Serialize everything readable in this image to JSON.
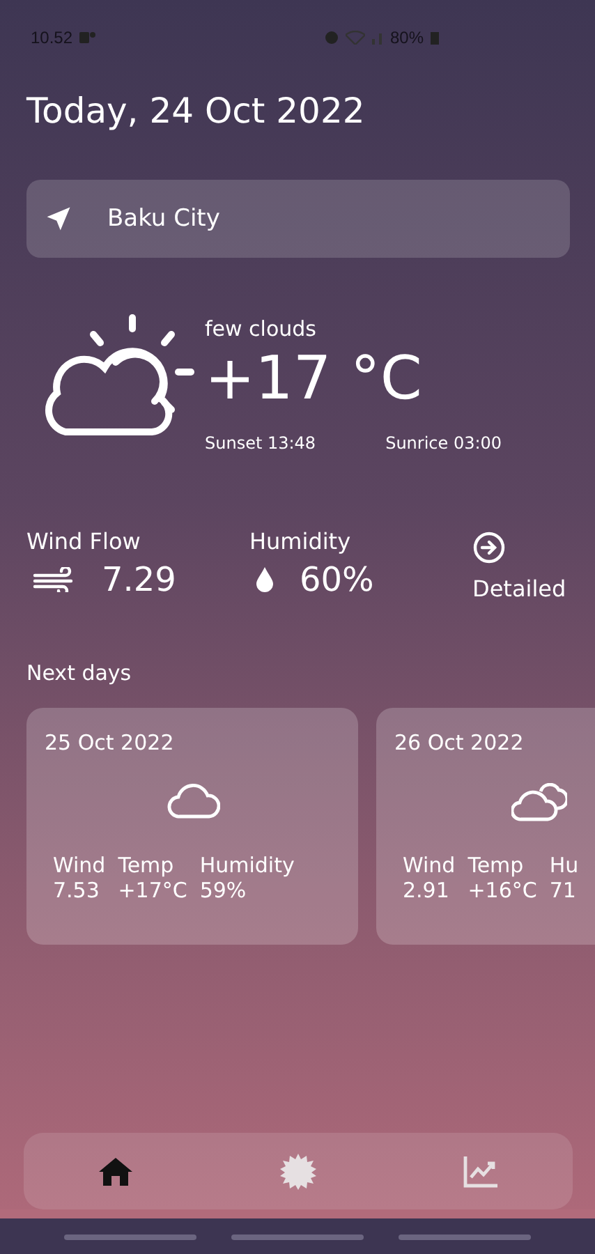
{
  "status_bar": {
    "time": "10.52",
    "battery": "80%"
  },
  "title": "Today, 24 Oct 2022",
  "location": {
    "name": "Baku City"
  },
  "current": {
    "description": "few clouds",
    "temperature": "+17 °C",
    "sunset": "Sunset 13:48",
    "sunrise": "Sunrice 03:00"
  },
  "stats": [
    {
      "label": "Wind Flow",
      "value": "7.29",
      "kind": "wind"
    },
    {
      "label": "Humidity",
      "value": "60%",
      "kind": "humidity"
    }
  ],
  "detailed": {
    "label": "Detailed"
  },
  "next_days": {
    "title": "Next days",
    "days": [
      {
        "date": "25 Oct 2022",
        "kind": "cloud",
        "stats": [
          {
            "label": "Wind",
            "value": "7.53"
          },
          {
            "label": "Temp",
            "value": "+17°C"
          },
          {
            "label": "Humidity",
            "value": "59%"
          }
        ]
      },
      {
        "date": "26 Oct 2022",
        "kind": "clouds",
        "stats": [
          {
            "label": "Wind",
            "value": "2.91"
          },
          {
            "label": "Temp",
            "value": "+16°C"
          },
          {
            "label": "Hu",
            "value": "71"
          }
        ]
      }
    ]
  },
  "nav": [
    {
      "kind": "home",
      "selected": true
    },
    {
      "kind": "weather",
      "selected": false
    },
    {
      "kind": "chart",
      "selected": false
    }
  ]
}
